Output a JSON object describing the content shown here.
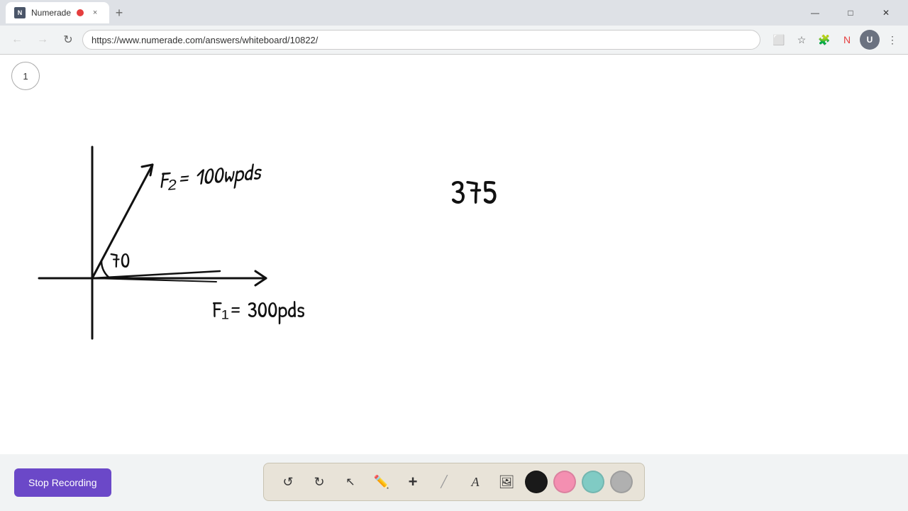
{
  "browser": {
    "tab": {
      "title": "Numerade",
      "favicon_label": "N",
      "close_label": "×",
      "recording_active": true
    },
    "new_tab_label": "+",
    "window_controls": {
      "minimize": "—",
      "maximize": "□",
      "close": "✕"
    },
    "nav": {
      "back_label": "←",
      "forward_label": "→",
      "reload_label": "↻",
      "url": "https://www.numerade.com/answers/whiteboard/10822/"
    }
  },
  "page": {
    "page_number": "1",
    "whiteboard_content": "handwritten math diagram with axes, vectors F2=100wpds and F1=300pds, angle 70, and number 375"
  },
  "toolbar": {
    "stop_recording_label": "Stop Recording",
    "tools": {
      "undo_label": "↺",
      "redo_label": "↻",
      "select_label": "▲",
      "pen_label": "✏",
      "plus_label": "+",
      "eraser_label": "/",
      "text_label": "A",
      "image_label": "🖼"
    },
    "colors": {
      "black": "#1a1a1a",
      "pink": "#f48fb1",
      "teal": "#80cbc4",
      "gray": "#b0b0b0"
    }
  }
}
